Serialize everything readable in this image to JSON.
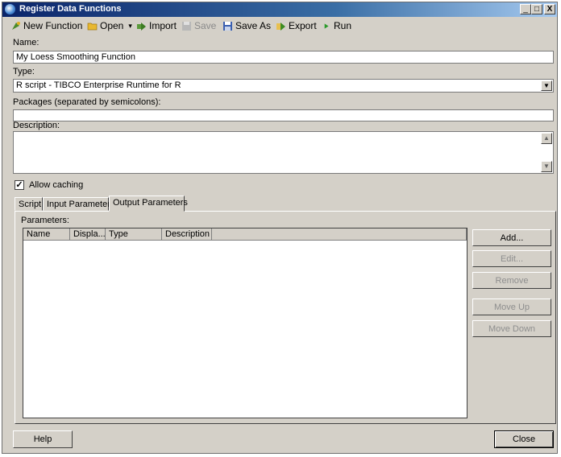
{
  "window": {
    "title": "Register Data Functions",
    "minimize": "_",
    "maximize": "□",
    "close": "X"
  },
  "toolbar": {
    "new_function": "New Function",
    "open": "Open",
    "open_arrow": "▾",
    "import": "Import",
    "save": "Save",
    "save_as": "Save As",
    "export": "Export",
    "run": "Run"
  },
  "form": {
    "name_label": "Name:",
    "name_value": "My Loess Smoothing Function",
    "type_label": "Type:",
    "type_value": "R script - TIBCO Enterprise Runtime for R",
    "packages_label": "Packages (separated by semicolons):",
    "packages_value": "",
    "description_label": "Description:",
    "description_value": "",
    "allow_caching_label": "Allow caching",
    "allow_caching_checked": true
  },
  "tabs": [
    {
      "label": "Script"
    },
    {
      "label": "Input Parameters"
    },
    {
      "label": "Output Parameters",
      "active": true
    }
  ],
  "parameters": {
    "label": "Parameters:",
    "columns": [
      "Name",
      "Displa...",
      "Type",
      "Description"
    ],
    "rows": []
  },
  "side_buttons": {
    "add": "Add...",
    "edit": "Edit...",
    "remove": "Remove",
    "move_up": "Move Up",
    "move_down": "Move Down"
  },
  "footer": {
    "help": "Help",
    "close": "Close"
  }
}
